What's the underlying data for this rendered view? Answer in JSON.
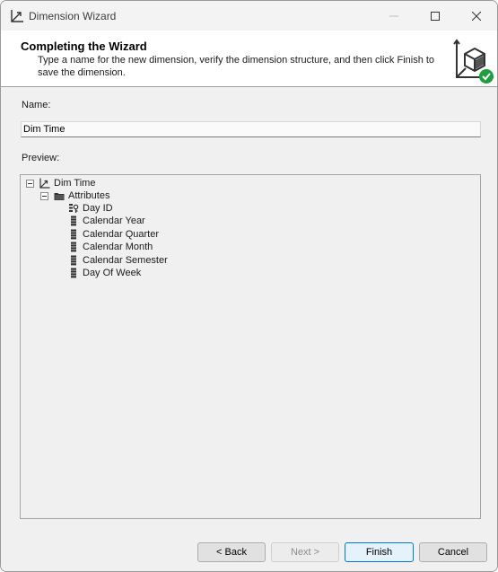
{
  "window": {
    "title": "Dimension Wizard"
  },
  "header": {
    "title": "Completing the Wizard",
    "description": "Type a name for the new dimension, verify the dimension structure, and then click Finish to save the dimension."
  },
  "form": {
    "name_label": "Name:",
    "name_value": "Dim Time",
    "preview_label": "Preview:"
  },
  "tree": {
    "root": {
      "label": "Dim Time",
      "icon": "dimension-icon",
      "expanded": true
    },
    "folder": {
      "label": "Attributes",
      "icon": "folder-icon",
      "expanded": true
    },
    "items": [
      {
        "label": "Day ID",
        "icon": "key-attribute-icon"
      },
      {
        "label": "Calendar Year",
        "icon": "attribute-icon"
      },
      {
        "label": "Calendar Quarter",
        "icon": "attribute-icon"
      },
      {
        "label": "Calendar Month",
        "icon": "attribute-icon"
      },
      {
        "label": "Calendar Semester",
        "icon": "attribute-icon"
      },
      {
        "label": "Day Of Week",
        "icon": "attribute-icon"
      }
    ]
  },
  "buttons": {
    "back": "< Back",
    "next": "Next >",
    "finish": "Finish",
    "cancel": "Cancel"
  },
  "colors": {
    "accent": "#0078d7",
    "success": "#1e9e3e"
  }
}
